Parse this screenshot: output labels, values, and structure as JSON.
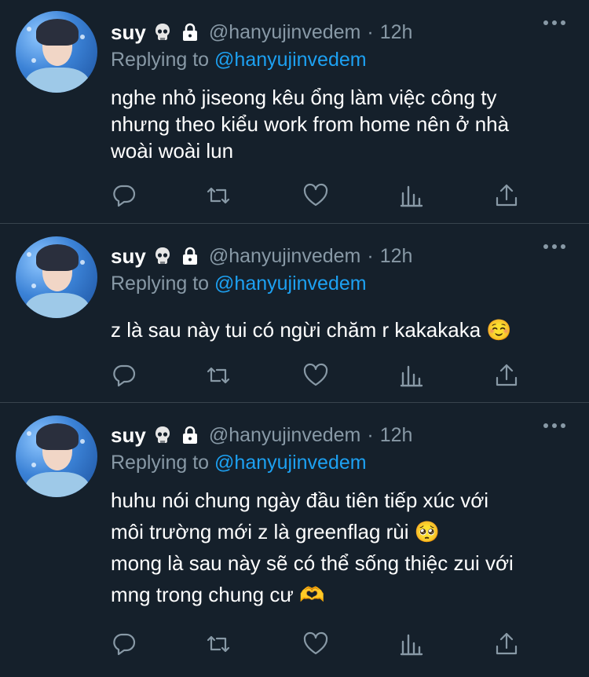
{
  "tweets": [
    {
      "name": "suy",
      "badge_emoji": "skull",
      "protected_icon": "lock-icon",
      "handle": "@hanyujinvedem",
      "separator": "·",
      "time": "12h",
      "reply_prefix": "Replying to",
      "reply_to": "@hanyujinvedem",
      "lines": [
        "nghe nhỏ jiseong kêu ổng làm việc công ty",
        "nhưng theo kiểu work from home nên ở nhà",
        "woài woài lun"
      ]
    },
    {
      "name": "suy",
      "badge_emoji": "skull",
      "protected_icon": "lock-icon",
      "handle": "@hanyujinvedem",
      "separator": "·",
      "time": "12h",
      "reply_prefix": "Replying to",
      "reply_to": "@hanyujinvedem",
      "lines": [
        "z là sau này tui có ngừi chăm r kakakaka ☺️"
      ]
    },
    {
      "name": "suy",
      "badge_emoji": "skull",
      "protected_icon": "lock-icon",
      "handle": "@hanyujinvedem",
      "separator": "·",
      "time": "12h",
      "reply_prefix": "Replying to",
      "reply_to": "@hanyujinvedem",
      "lines": [
        "huhu nói chung ngày đầu tiên tiếp xúc với",
        "môi trường mới z là greenflag rùi 🥺",
        "mong là sau này sẽ có thể sống thiệc zui với",
        "mng trong chung cư 🫶"
      ]
    }
  ],
  "action_icons": [
    "reply-icon",
    "retweet-icon",
    "like-icon",
    "analytics-icon",
    "share-icon"
  ],
  "colors": {
    "background": "#15202b",
    "divider": "#38444d",
    "secondary_text": "#8899a6",
    "accent": "#1da1f2"
  }
}
